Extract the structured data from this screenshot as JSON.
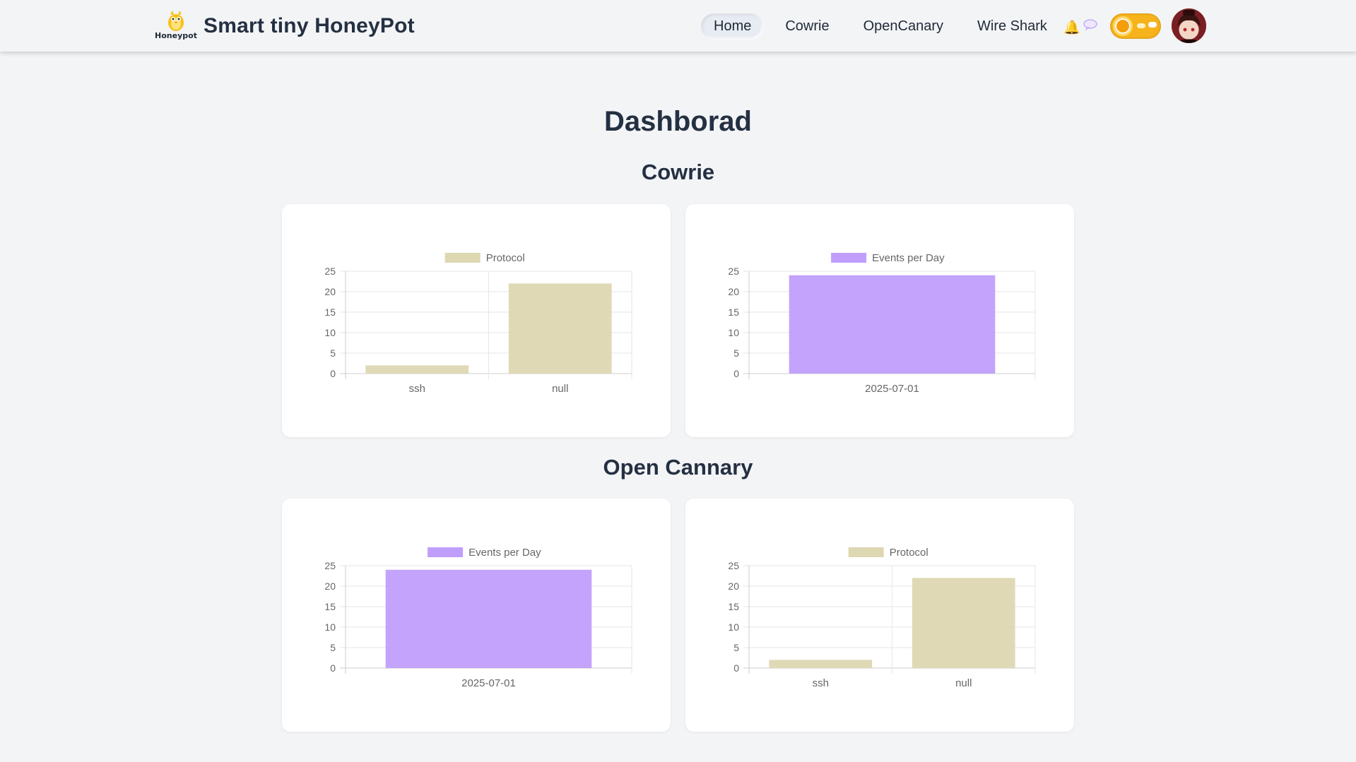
{
  "header": {
    "logo_text": "Honeypot",
    "title": "Smart tiny HoneyPot",
    "nav": [
      {
        "label": "Home",
        "active": true
      },
      {
        "label": "Cowrie",
        "active": false
      },
      {
        "label": "OpenCanary",
        "active": false
      },
      {
        "label": "Wire Shark",
        "active": false
      }
    ],
    "icons": [
      "bell-icon",
      "chat-icon"
    ],
    "theme_toggle": "light"
  },
  "page": {
    "title": "Dashborad",
    "sections": [
      {
        "title": "Cowrie"
      },
      {
        "title": "Open Cannary"
      }
    ]
  },
  "chart_data": [
    {
      "type": "bar",
      "section": "Cowrie",
      "legend": "Protocol",
      "color": "#ddd7b2",
      "categories": [
        "ssh",
        "null"
      ],
      "values": [
        2,
        22
      ],
      "ylim": [
        0,
        25
      ],
      "yticks": [
        0,
        5,
        10,
        15,
        20,
        25
      ],
      "grid": true
    },
    {
      "type": "bar",
      "section": "Cowrie",
      "legend": "Events per Day",
      "color": "#c09efb",
      "categories": [
        "2025-07-01"
      ],
      "values": [
        24
      ],
      "ylim": [
        0,
        25
      ],
      "yticks": [
        0,
        5,
        10,
        15,
        20,
        25
      ],
      "grid": true
    },
    {
      "type": "bar",
      "section": "Open Cannary",
      "legend": "Events per Day",
      "color": "#c09efb",
      "categories": [
        "2025-07-01"
      ],
      "values": [
        24
      ],
      "ylim": [
        0,
        25
      ],
      "yticks": [
        0,
        5,
        10,
        15,
        20,
        25
      ],
      "grid": true
    },
    {
      "type": "bar",
      "section": "Open Cannary",
      "legend": "Protocol",
      "color": "#ddd7b2",
      "categories": [
        "ssh",
        "null"
      ],
      "values": [
        2,
        22
      ],
      "ylim": [
        0,
        25
      ],
      "yticks": [
        0,
        5,
        10,
        15,
        20,
        25
      ],
      "grid": true
    }
  ]
}
